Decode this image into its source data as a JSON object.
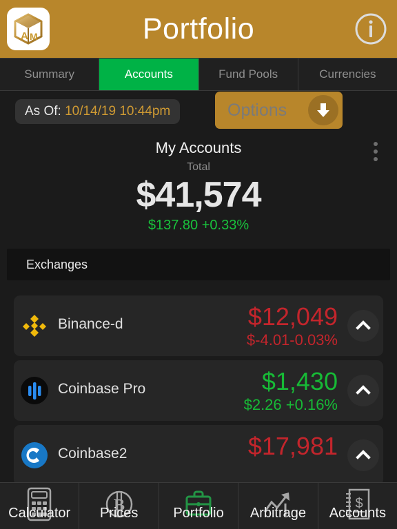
{
  "header": {
    "title": "Portfolio",
    "logo_icon": "app-cube-logo-icon",
    "logo_text": "AM",
    "info_icon": "info-circle-icon",
    "bg_color": "#b8862b"
  },
  "tabs": [
    {
      "label": "Summary",
      "active": false
    },
    {
      "label": "Accounts",
      "active": true
    },
    {
      "label": "Fund Pools",
      "active": false
    },
    {
      "label": "Currencies",
      "active": false
    }
  ],
  "tab_active_color": "#00b246",
  "asof": {
    "label": "As Of:",
    "value": "10/14/19 10:44pm",
    "value_color": "#cf9a33"
  },
  "options_button": {
    "label": "Options",
    "icon": "arrow-down-icon"
  },
  "summary": {
    "title": "My Accounts",
    "subtitle": "Total",
    "total": "$41,574",
    "change": "$137.80 +0.33%",
    "change_color": "#19c23c",
    "menu_icon": "kebab-menu-icon"
  },
  "section": {
    "title": "Exchanges"
  },
  "accounts": [
    {
      "name": "Binance-d",
      "icon": "binance-logo-icon",
      "value": "$12,049",
      "change": "$-4.01-0.03%",
      "direction": "down",
      "chevron": "chevron-up-icon"
    },
    {
      "name": "Coinbase Pro",
      "icon": "coinbase-pro-logo-icon",
      "value": "$1,430",
      "change": "$2.26 +0.16%",
      "direction": "up",
      "chevron": "chevron-up-icon"
    },
    {
      "name": "Coinbase2",
      "icon": "coinbase-logo-icon",
      "value": "$17,981",
      "change": "",
      "direction": "down",
      "chevron": "chevron-up-icon"
    }
  ],
  "colors": {
    "up": "#17ba36",
    "down": "#c3252c",
    "accent_gold": "#b8862b",
    "accent_green": "#00b246"
  },
  "bottom_nav": [
    {
      "label": "Calculator",
      "icon": "calculator-icon",
      "active": false
    },
    {
      "label": "Prices",
      "icon": "bitcoin-icon",
      "active": false
    },
    {
      "label": "Portfolio",
      "icon": "briefcase-icon",
      "active": true
    },
    {
      "label": "Arbitrage",
      "icon": "trend-up-icon",
      "active": false
    },
    {
      "label": "Accounts",
      "icon": "ledger-icon",
      "active": false
    }
  ]
}
